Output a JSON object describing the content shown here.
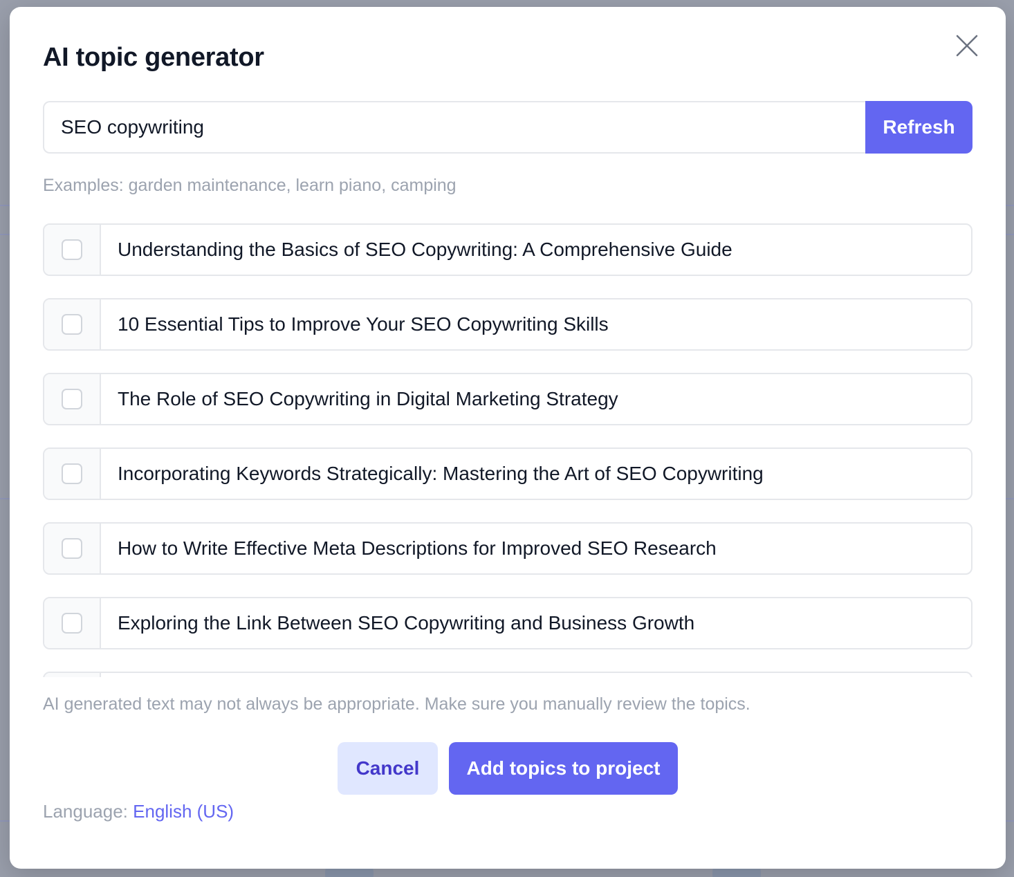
{
  "modal": {
    "title": "AI topic generator"
  },
  "search": {
    "value": "SEO copywriting",
    "refresh_label": "Refresh",
    "examples": "Examples: garden maintenance, learn piano, camping"
  },
  "topics": [
    {
      "label": "Understanding the Basics of SEO Copywriting: A Comprehensive Guide",
      "checked": false
    },
    {
      "label": "10 Essential Tips to Improve Your SEO Copywriting Skills",
      "checked": false
    },
    {
      "label": "The Role of SEO Copywriting in Digital Marketing Strategy",
      "checked": false
    },
    {
      "label": "Incorporating Keywords Strategically: Mastering the Art of SEO Copywriting",
      "checked": false
    },
    {
      "label": "How to Write Effective Meta Descriptions for Improved SEO Research",
      "checked": false
    },
    {
      "label": "Exploring the Link Between SEO Copywriting and Business Growth",
      "checked": false
    },
    {
      "label": "",
      "checked": false
    }
  ],
  "disclaimer": "AI generated text may not always be appropriate. Make sure you manually review the topics.",
  "actions": {
    "cancel_label": "Cancel",
    "add_label": "Add topics to project"
  },
  "language": {
    "label": "Language:",
    "value": "English (US)"
  },
  "colors": {
    "accent": "#6366f1",
    "accent_light": "#e0e7ff",
    "accent_text": "#4338ca",
    "muted_text": "#9ca3af",
    "border": "#e5e7eb"
  },
  "icons": {
    "close": "close-icon"
  }
}
